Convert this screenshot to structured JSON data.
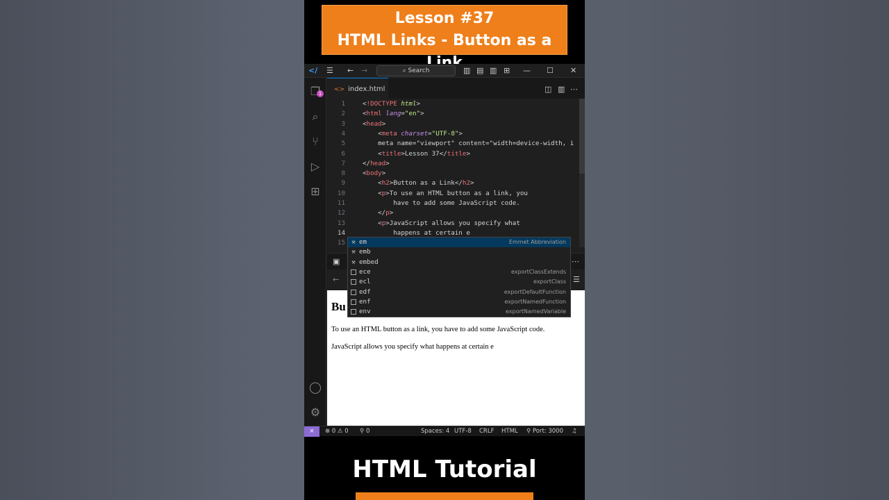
{
  "banner": {
    "line1": "Lesson #37",
    "line2": "HTML Links - Button as a Link"
  },
  "titlebar": {
    "search_label": "Search"
  },
  "activity": {
    "explorer_badge": "1"
  },
  "tab": {
    "icon": "<>",
    "filename": "index.html"
  },
  "editor": {
    "current_line": 14,
    "lines": [
      {
        "n": "1",
        "text": "<!DOCTYPE html>"
      },
      {
        "n": "2",
        "text": "<html lang=\"en\">"
      },
      {
        "n": "3",
        "text": "<head>"
      },
      {
        "n": "4",
        "text": "    <meta charset=\"UTF-8\">"
      },
      {
        "n": "5",
        "text": "    <meta name=\"viewport\" content=\"width=device-width, i"
      },
      {
        "n": "6",
        "text": "    <title>Lesson 37</title>"
      },
      {
        "n": "7",
        "text": "</head>"
      },
      {
        "n": "8",
        "text": "<body>"
      },
      {
        "n": "9",
        "text": "    <h2>Button as a Link</h2>"
      },
      {
        "n": "10",
        "text": "    <p>To use an HTML button as a link, you"
      },
      {
        "n": "11",
        "text": "        have to add some JavaScript code."
      },
      {
        "n": "12",
        "text": "    </p>"
      },
      {
        "n": "13",
        "text": "    <p>JavaScript allows you specify what"
      },
      {
        "n": "14",
        "text": "        happens at certain e"
      },
      {
        "n": "15",
        "text": ""
      }
    ]
  },
  "suggest": {
    "items": [
      {
        "label": "em",
        "match": "e",
        "detail": "Emmet Abbreviation",
        "icon": "wrench-icon",
        "selected": true
      },
      {
        "label": "emb",
        "match": "e",
        "detail": "",
        "icon": "wrench-icon",
        "selected": false
      },
      {
        "label": "embed",
        "match": "e",
        "detail": "",
        "icon": "wrench-icon",
        "selected": false
      },
      {
        "label": "ece",
        "match": "e",
        "detail": "exportClassExtends",
        "icon": "snippet-icon",
        "selected": false
      },
      {
        "label": "ecl",
        "match": "e",
        "detail": "exportClass",
        "icon": "snippet-icon",
        "selected": false
      },
      {
        "label": "edf",
        "match": "e",
        "detail": "exportDefaultFunction",
        "icon": "snippet-icon",
        "selected": false
      },
      {
        "label": "enf",
        "match": "e",
        "detail": "exportNamedFunction",
        "icon": "snippet-icon",
        "selected": false
      },
      {
        "label": "env",
        "match": "e",
        "detail": "exportNamedVariable",
        "icon": "snippet-icon",
        "selected": false
      }
    ]
  },
  "preview": {
    "heading": "Bu",
    "p1": "To use an HTML button as a link, you have to add some JavaScript code.",
    "p2": "JavaScript allows you specify what happens at certain e"
  },
  "statusbar": {
    "errors": "0",
    "warnings": "0",
    "ports": "0",
    "spaces": "Spaces: 4",
    "encoding": "UTF-8",
    "eol": "CRLF",
    "language": "HTML",
    "port": "Port: 3000"
  },
  "footer": {
    "title": "HTML Tutorial"
  },
  "colors": {
    "accent_orange": "#ef7f1a",
    "remote_purple": "#8d6bd5",
    "tab_active_border": "#0078d4"
  }
}
